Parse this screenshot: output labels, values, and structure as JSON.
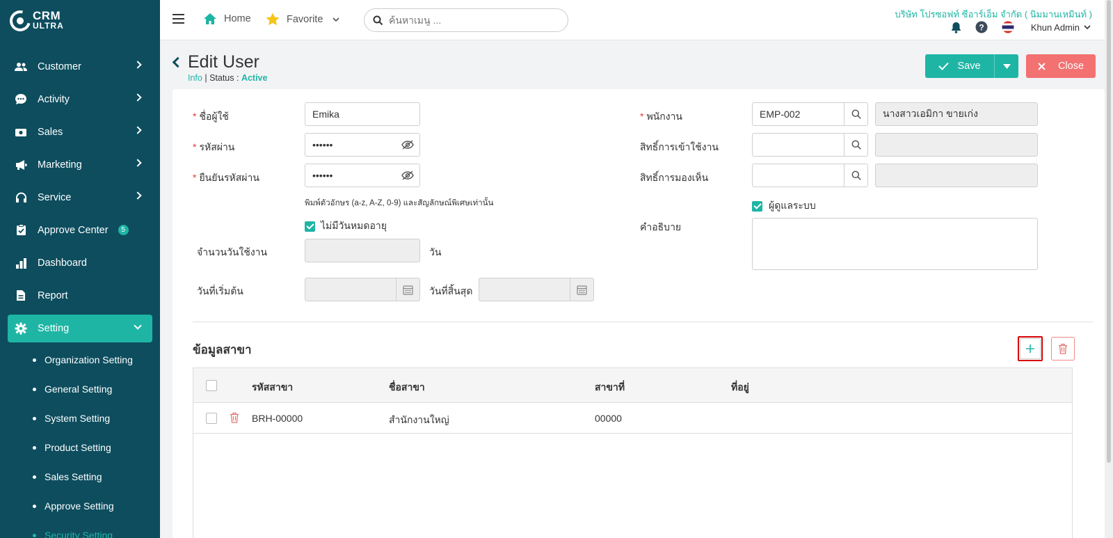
{
  "brand": {
    "name_line1": "CRM",
    "name_line2": "ULTRA"
  },
  "sidebar": {
    "items": [
      {
        "label": "Customer",
        "icon": "users-icon"
      },
      {
        "label": "Activity",
        "icon": "chat-icon"
      },
      {
        "label": "Sales",
        "icon": "money-icon"
      },
      {
        "label": "Marketing",
        "icon": "megaphone-icon"
      },
      {
        "label": "Service",
        "icon": "headset-icon"
      },
      {
        "label": "Approve Center",
        "icon": "clipboard-check-icon",
        "badge": "5"
      },
      {
        "label": "Dashboard",
        "icon": "bar-chart-icon"
      },
      {
        "label": "Report",
        "icon": "document-icon"
      },
      {
        "label": "Setting",
        "icon": "gear-icon"
      }
    ],
    "setting_sub": [
      "Organization Setting",
      "General Setting",
      "System Setting",
      "Product Setting",
      "Sales Setting",
      "Approve Setting",
      "Security Setting"
    ]
  },
  "topbar": {
    "home": "Home",
    "favorite": "Favorite",
    "search_placeholder": "ค้นหาเมนู ...",
    "company": "บริษัท โปรซอฟท์ ซีอาร์เอ็ม จำกัด ( นิมมานเหมินท์ )",
    "user": "Khun Admin"
  },
  "header": {
    "title": "Edit User",
    "info": "Info",
    "status_label": "| Status :",
    "status_value": "Active",
    "save": "Save",
    "close": "Close"
  },
  "form": {
    "username_label": "ชื่อผู้ใช้",
    "username_value": "Emika",
    "password_label": "รหัสผ่าน",
    "password_value": "••••••",
    "confirm_label": "ยืนยันรหัสผ่าน",
    "confirm_value": "••••••",
    "password_hint": "พิมพ์ตัวอักษร (a-z, A-Z, 0-9) และสัญลักษณ์พิเศษเท่านั้น",
    "no_expire_label": "ไม่มีวันหมดอายุ",
    "days_label": "จำนวนวันใช้งาน",
    "days_unit": "วัน",
    "start_label": "วันที่เริ่มต้น",
    "end_label": "วันที่สิ้นสุด",
    "employee_label": "พนักงาน",
    "employee_code": "EMP-002",
    "employee_name": "นางสาวเอมิกา ขายเก่ง",
    "access_label": "สิทธิ์การเข้าใช้งาน",
    "view_label": "สิทธิ์การมองเห็น",
    "admin_label": "ผู้ดูแลระบบ",
    "desc_label": "คำอธิบาย"
  },
  "branch": {
    "title": "ข้อมูลสาขา",
    "columns": [
      "รหัสสาขา",
      "ชื่อสาขา",
      "สาขาที่",
      "ที่อยู่"
    ],
    "rows": [
      {
        "code": "BRH-00000",
        "name": "สำนักงานใหญ่",
        "no": "00000",
        "address": ""
      }
    ]
  },
  "colors": {
    "teal": "#1fb5a5",
    "navy": "#0d4d5e",
    "danger": "#f37171"
  }
}
